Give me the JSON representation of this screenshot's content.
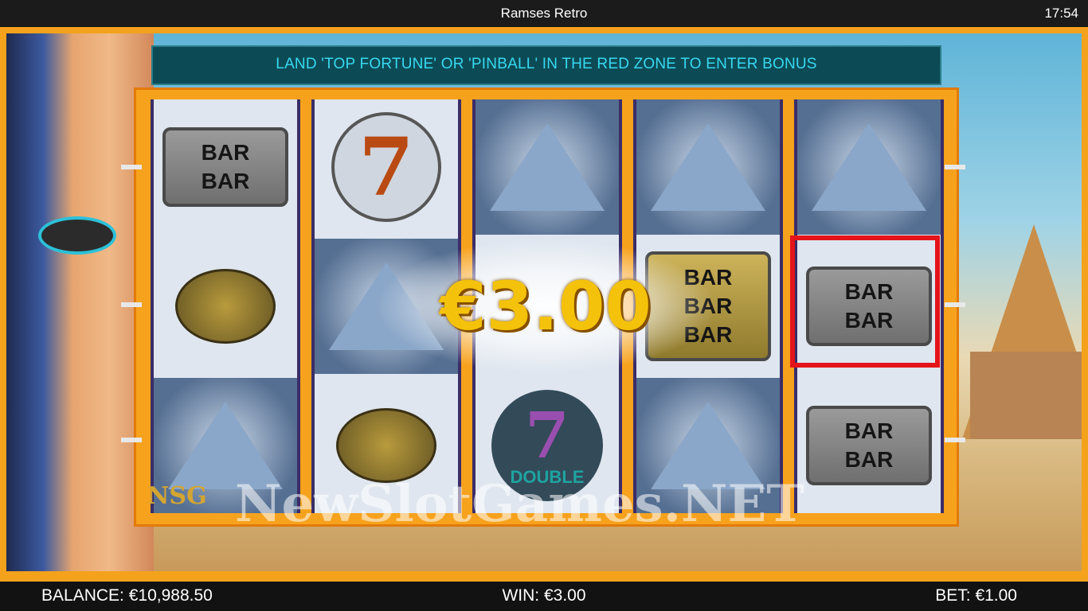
{
  "window": {
    "title": "Ramses Retro",
    "clock": "17:54"
  },
  "banner": {
    "text": "LAND 'TOP FORTUNE' OR 'PINBALL' IN THE RED ZONE TO ENTER BONUS"
  },
  "win_popup": {
    "amount": "€3.00"
  },
  "symbols": {
    "bar": "BAR",
    "seven": "7",
    "double_label": "DOUBLE"
  },
  "watermark": {
    "logo": "NSG",
    "text": "NewSlotGames.NET"
  },
  "footer": {
    "balance_label": "BALANCE:",
    "balance_value": "€10,988.50",
    "win_label": "WIN:",
    "win_value": "€3.00",
    "bet_label": "BET:",
    "bet_value": "€1.00"
  },
  "colors": {
    "frame": "#f4a21b",
    "banner_text": "#38d8f0",
    "red_zone": "#e4141a",
    "win_text": "#f4c20a"
  }
}
